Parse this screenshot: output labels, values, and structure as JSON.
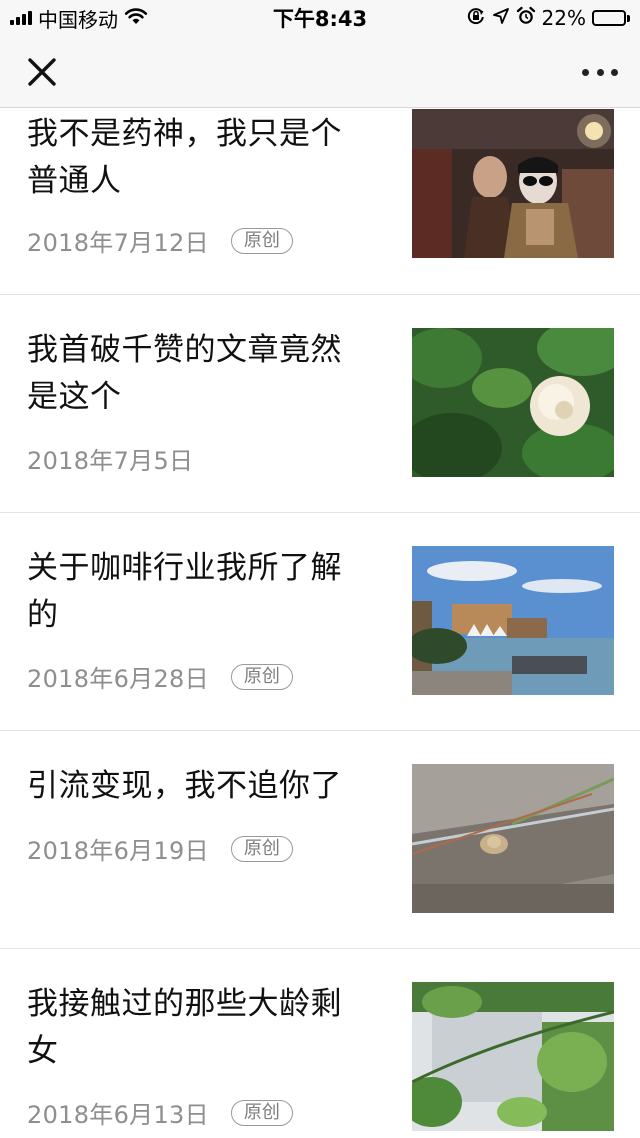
{
  "status_bar": {
    "carrier": "中国移动",
    "time": "下午8:43",
    "battery": "22%",
    "battery_level": 0.22,
    "icons": [
      "signal-icon",
      "wifi-icon",
      "rotation-lock-icon",
      "location-icon",
      "alarm-icon",
      "battery-icon"
    ]
  },
  "nav": {
    "close_icon": "close-icon",
    "more_icon": "more-icon"
  },
  "articles": [
    {
      "title_lines": [
        "我不是药神，我只是个",
        "普通人"
      ],
      "date": "2018年7月12日",
      "badge": "原创"
    },
    {
      "title_lines": [
        "我首破千赞的文章竟然",
        "是这个"
      ],
      "date": "2018年7月5日",
      "badge": ""
    },
    {
      "title_lines": [
        "关于咖啡行业我所了解",
        "的"
      ],
      "date": "2018年6月28日",
      "badge": "原创"
    },
    {
      "title_lines": [
        "引流变现，我不追你了"
      ],
      "date": "2018年6月19日",
      "badge": "原创"
    },
    {
      "title_lines": [
        "我接触过的那些大龄剩",
        "女"
      ],
      "date": "2018年6月13日",
      "badge": "原创"
    }
  ]
}
